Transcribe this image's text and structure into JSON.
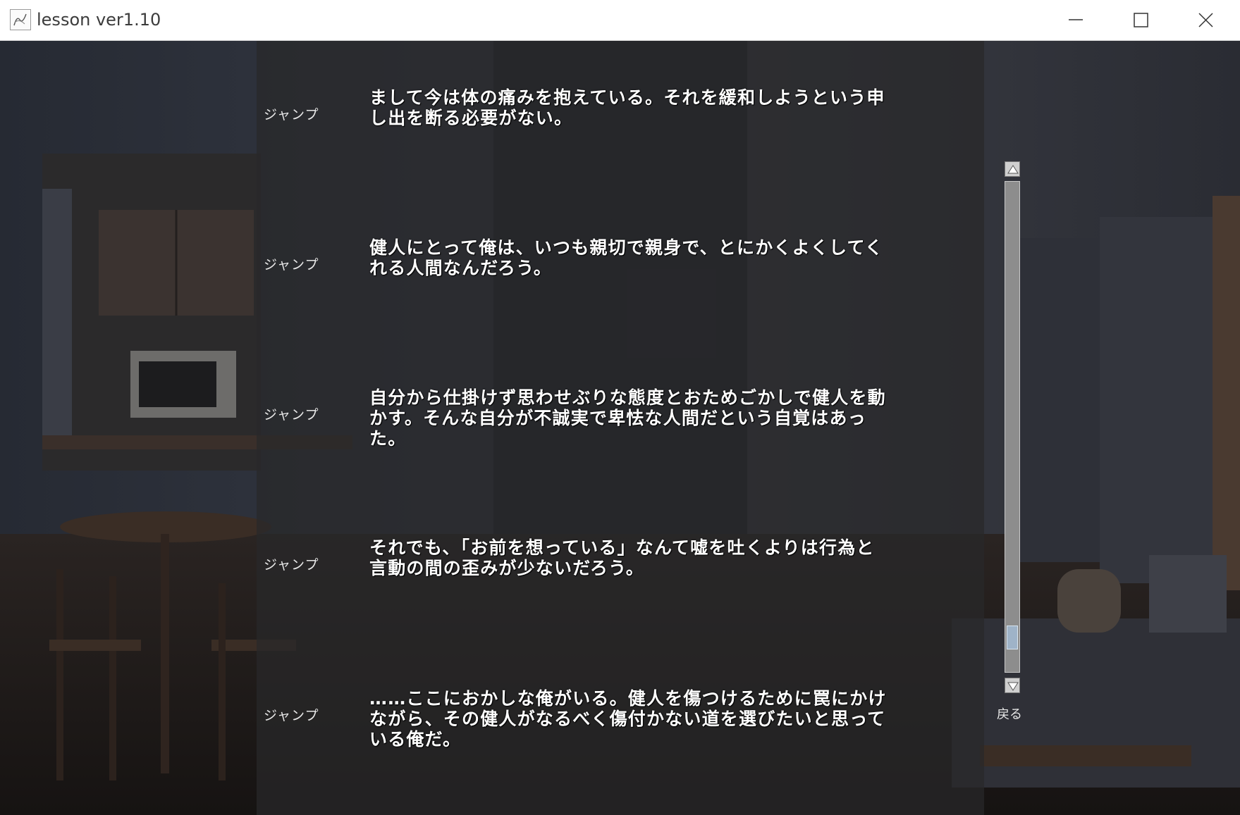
{
  "window": {
    "title": "lesson ver1.10"
  },
  "backlog": {
    "entries": [
      {
        "jump_label": "ジャンプ",
        "text": "まして今は体の痛みを抱えている。それを緩和しようという申し出を断る必要がない。"
      },
      {
        "jump_label": "ジャンプ",
        "text": "健人にとって俺は、いつも親切で親身で、とにかくよくしてくれる人間なんだろう。"
      },
      {
        "jump_label": "ジャンプ",
        "text": "自分から仕掛けず思わせぶりな態度とおためごかしで健人を動かす。そんな自分が不誠実で卑怯な人間だという自覚はあった。"
      },
      {
        "jump_label": "ジャンプ",
        "text": "それでも、「お前を想っている」なんて嘘を吐くよりは行為と言動の間の歪みが少ないだろう。"
      },
      {
        "jump_label": "ジャンプ",
        "text": "……ここにおかしな俺がいる。健人を傷つけるために罠にかけながら、その健人がなるべく傷付かない道を選びたいと思っている俺だ。"
      }
    ],
    "back_label": "戻る"
  },
  "icons": {
    "minimize": "minimize-icon",
    "maximize": "maximize-icon",
    "close": "close-icon",
    "scroll_up": "arrow-up-icon",
    "scroll_down": "arrow-down-icon"
  },
  "colors": {
    "panel": "#28282a",
    "text": "#ffffff",
    "scroll_thumb": "#9fb3c8"
  }
}
